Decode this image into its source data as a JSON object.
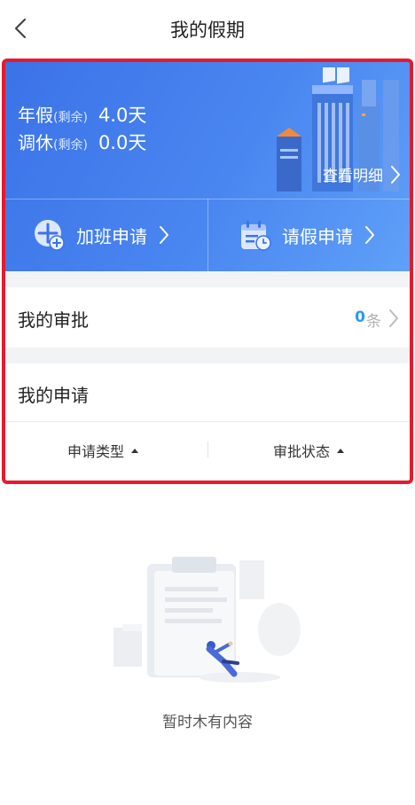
{
  "header": {
    "title": "我的假期",
    "back_icon": "chevron-left-icon"
  },
  "balance": {
    "annual": {
      "label": "年假",
      "sub": "(剩余)",
      "value": "4.0天"
    },
    "compensatory": {
      "label": "调休",
      "sub": "(剩余)",
      "value": "0.0天"
    },
    "detail_link": "查看明细"
  },
  "actions": {
    "overtime": {
      "label": "加班申请",
      "icon": "overtime-add-icon"
    },
    "leave": {
      "label": "请假申请",
      "icon": "calendar-clock-icon"
    }
  },
  "approval": {
    "label": "我的审批",
    "count": "0",
    "unit": "条"
  },
  "applications": {
    "label": "我的申请",
    "filter_type": "申请类型",
    "filter_status": "审批状态"
  },
  "empty_state": {
    "text": "暂时木有内容"
  },
  "colors": {
    "hero_blue": "#4a86f0",
    "count_blue": "#2b9af3",
    "highlight_red": "#e8192c"
  }
}
